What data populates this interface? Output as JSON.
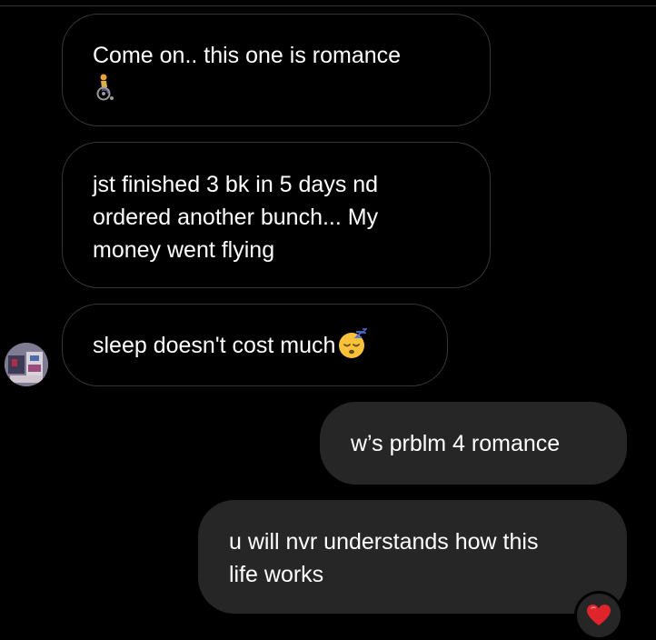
{
  "messages": [
    {
      "text": "Come on.. this one is romance",
      "emoji": "person-in-wheelchair"
    },
    {
      "text": "jst finished 3 bk in 5 days nd\nordered another bunch... My\nmoney went flying"
    },
    {
      "text": "sleep doesn't cost much",
      "emoji": "sleeping-face"
    },
    {
      "text": "w’s prblm 4 romance"
    },
    {
      "text": "u will nvr understands how this\nlife works",
      "reaction": "red-heart"
    }
  ],
  "colors": {
    "background": "#000000",
    "incoming_border": "#363636",
    "outgoing_bubble": "#262626",
    "heart": "#e0242b"
  }
}
